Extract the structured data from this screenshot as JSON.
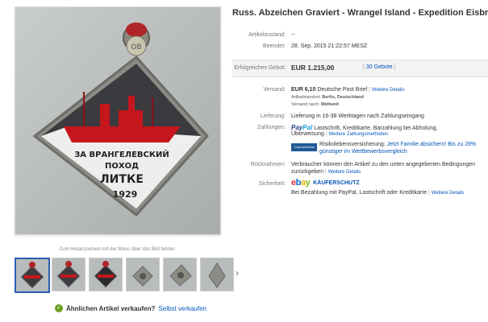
{
  "title": "Russ. Abzeichen Graviert - Wrangel Island - Expedition Eisbrecher",
  "badge_text": {
    "line1": "ЗА ВРАНГЕЛЕВСКИЙ",
    "line2": "ПОХОД",
    "line3": "ЛИТКЕ",
    "line4": "1929"
  },
  "zoom_hint": "Zum Heranzoomen mit der Maus über das Bild fahren",
  "sell": {
    "question": "Ähnlichen Artikel verkaufen?",
    "link": "Selbst verkaufen"
  },
  "details": {
    "condition_label": "Artikelzustand:",
    "condition_value": "--",
    "ended_label": "Beendet:",
    "ended_value": "28. Sep. 2015  21:22:57 MESZ",
    "bid_label": "Erfolgreiches Gebot:",
    "bid_price": "EUR 1.215,00",
    "bid_count": "30 Gebote",
    "shipping_label": "Versand:",
    "shipping_cost": "EUR 6,10",
    "shipping_method": "Deutsche Post Brief",
    "more_details": "Weitere Details",
    "location_label": "Artikelstandort:",
    "location_value": "Berlin, Deutschland",
    "ship_to_label": "Versand nach:",
    "ship_to_value": "Weltweit",
    "delivery_label": "Lieferung:",
    "delivery_value": "Lieferung in 16-38 Werktagen nach Zahlungseingang",
    "payment_label": "Zahlungen:",
    "payment_value": "Lastschrift, Kreditkarte, Barzahlung bei Abholung,",
    "payment_value2": "Überweisung",
    "payment_more": "Weitere Zahlungsmethoden",
    "insurance_logo": "CosmosDirekt",
    "insurance_text": "Risikolebensversicherung:",
    "insurance_link": "Jetzt Familie absichern! Bis zu 28%",
    "insurance_link2": "günstiger im Wettbewerbsvergleich",
    "returns_label": "Rücknahmen:",
    "returns_value": "Verbraucher können den Artikel zu den unten angegebenen Bedingungen",
    "returns_value2": "zurückgeben",
    "security_label": "Sicherheit:",
    "kauferschutz": "KÄUFERSCHUTZ",
    "security_value": "Bei Bezahlung mit PayPal, Lastschrift oder Kreditkarte",
    "paypal_a": "Pay",
    "paypal_b": "Pal",
    "ebay_letters": [
      "e",
      "b",
      "a",
      "y"
    ],
    "sep": "|"
  },
  "thumbnails": [
    "badge-front",
    "badge-front-angle",
    "badge-front-dark",
    "badge-back",
    "badge-back-angle",
    "badge-side"
  ],
  "icons": {
    "prev": "‹",
    "next": "›"
  }
}
